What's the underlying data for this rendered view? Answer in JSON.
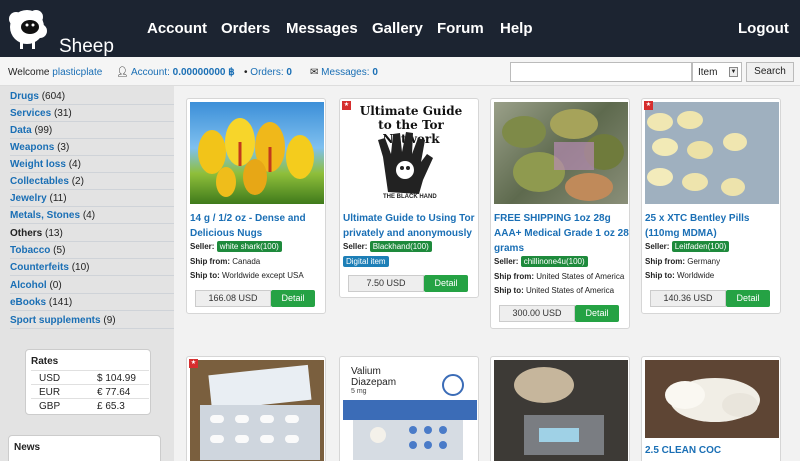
{
  "nav": {
    "logo_text": "Sheep",
    "items": [
      "Account",
      "Orders",
      "Messages",
      "Gallery",
      "Forum",
      "Help"
    ],
    "logout": "Logout"
  },
  "subbar": {
    "welcome": "Welcome",
    "username": "plasticplate",
    "account_label": "Account:",
    "account_value": "0.00000000 ฿",
    "orders_label": "Orders:",
    "orders_value": "0",
    "messages_label": "Messages:",
    "messages_value": "0"
  },
  "search": {
    "value": "",
    "select_value": "Item",
    "button": "Search"
  },
  "categories": [
    {
      "name": "Drugs",
      "count": "(604)"
    },
    {
      "name": "Services",
      "count": "(31)"
    },
    {
      "name": "Data",
      "count": "(99)"
    },
    {
      "name": "Weapons",
      "count": "(3)"
    },
    {
      "name": "Weight loss",
      "count": "(4)"
    },
    {
      "name": "Collectables",
      "count": "(2)"
    },
    {
      "name": "Jewelry",
      "count": "(11)"
    },
    {
      "name": "Metals, Stones",
      "count": "(4)"
    },
    {
      "name": "Others",
      "count": "(13)"
    },
    {
      "name": "Tobacco",
      "count": "(5)"
    },
    {
      "name": "Counterfeits",
      "count": "(10)"
    },
    {
      "name": "Alcohol",
      "count": "(0)"
    },
    {
      "name": "eBooks",
      "count": "(141)"
    },
    {
      "name": "Sport supplements",
      "count": "(9)"
    }
  ],
  "rates": {
    "title": "Rates",
    "rows": [
      {
        "cur": "USD",
        "val": "$ 104.99"
      },
      {
        "cur": "EUR",
        "val": "€ 77.64"
      },
      {
        "cur": "GBP",
        "val": "£ 65.3"
      }
    ]
  },
  "news": {
    "title": "News"
  },
  "labels": {
    "seller": "Seller:",
    "ship_from": "Ship from:",
    "ship_to": "Ship to:",
    "detail": "Detail",
    "star": "★"
  },
  "listings": [
    {
      "title": "14 g / 1/2 oz - Dense and Delicious Nugs",
      "seller": "white shark(100)",
      "ship_from": "Canada",
      "ship_to": "Worldwide except USA",
      "price": "166.08 USD"
    },
    {
      "title": "Ultimate Guide to Using Tor privately and anonymously",
      "seller": "Blackhand(100)",
      "digital": "Digital item",
      "price": "7.50 USD",
      "img_text": "Ultimate Guide to the Tor Network",
      "img_sub": "THE BLACK HAND"
    },
    {
      "title": "FREE SHIPPING 1oz 28g AAA+ Medical Grade 1 oz 28 grams",
      "seller": "chillinone4u(100)",
      "ship_from": "United States of America",
      "ship_to": "United States of America",
      "price": "300.00 USD"
    },
    {
      "title": "25 x XTC Bentley Pills (110mg MDMA)",
      "seller": "Leitfaden(100)",
      "ship_from": "Germany",
      "ship_to": "Worldwide",
      "price": "140.36 USD"
    },
    {
      "title": "2.5 CLEAN COC",
      "img_text": "Valium Diazepam",
      "img_sub": "5 mg"
    }
  ]
}
